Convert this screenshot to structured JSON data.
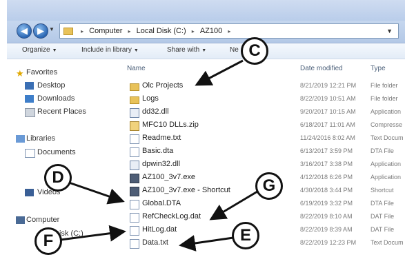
{
  "address": {
    "crumbs": [
      "Computer",
      "Local Disk (C:)",
      "AZ100"
    ],
    "separator": "▸"
  },
  "toolbar": {
    "organize": "Organize",
    "include": "Include in library",
    "share": "Share with",
    "new_folder": "Ne"
  },
  "sidebar": {
    "favorites": "Favorites",
    "desktop": "Desktop",
    "downloads": "Downloads",
    "recent": "Recent Places",
    "libraries": "Libraries",
    "documents": "Documents",
    "videos": "Videos",
    "computer": "Computer",
    "local_disk": "Disk (C:)"
  },
  "columns": {
    "name": "Name",
    "date": "Date modified",
    "type": "Type"
  },
  "files": [
    {
      "name": "Olc Projects",
      "date": "8/21/2019 12:21 PM",
      "type": "File folder",
      "icon": "folder-icon"
    },
    {
      "name": "Logs",
      "date": "8/22/2019 10:51 AM",
      "type": "File folder",
      "icon": "folder-icon"
    },
    {
      "name": "dd32.dll",
      "date": "9/20/2017 10:15 AM",
      "type": "Application",
      "icon": "dll-icon"
    },
    {
      "name": "MFC10 DLLs.zip",
      "date": "6/18/2017 11:01 AM",
      "type": "Compresse",
      "icon": "zip-icon"
    },
    {
      "name": "Readme.txt",
      "date": "11/24/2016 8:02 AM",
      "type": "Text Docum",
      "icon": "text-file-icon"
    },
    {
      "name": "Basic.dta",
      "date": "6/13/2017 3:59 PM",
      "type": "DTA File",
      "icon": "file-icon"
    },
    {
      "name": "dpwin32.dll",
      "date": "3/16/2017 3:38 PM",
      "type": "Application",
      "icon": "dll-icon"
    },
    {
      "name": "AZ100_3v7.exe",
      "date": "4/12/2018 6:26 PM",
      "type": "Application",
      "icon": "exe-icon"
    },
    {
      "name": "AZ100_3v7.exe - Shortcut",
      "date": "4/30/2018 3:44 PM",
      "type": "Shortcut",
      "icon": "shortcut-icon"
    },
    {
      "name": "Global.DTA",
      "date": "6/19/2019 3:32 PM",
      "type": "DTA File",
      "icon": "file-icon"
    },
    {
      "name": "RefCheckLog.dat",
      "date": "8/22/2019 8:10 AM",
      "type": "DAT File",
      "icon": "file-icon"
    },
    {
      "name": "HitLog.dat",
      "date": "8/22/2019 8:39 AM",
      "type": "DAT File",
      "icon": "file-icon"
    },
    {
      "name": "Data.txt",
      "date": "8/22/2019 12:23 PM",
      "type": "Text Docum",
      "icon": "text-file-icon"
    }
  ],
  "callouts": {
    "c": "C",
    "d": "D",
    "e": "E",
    "f": "F",
    "g": "G"
  }
}
